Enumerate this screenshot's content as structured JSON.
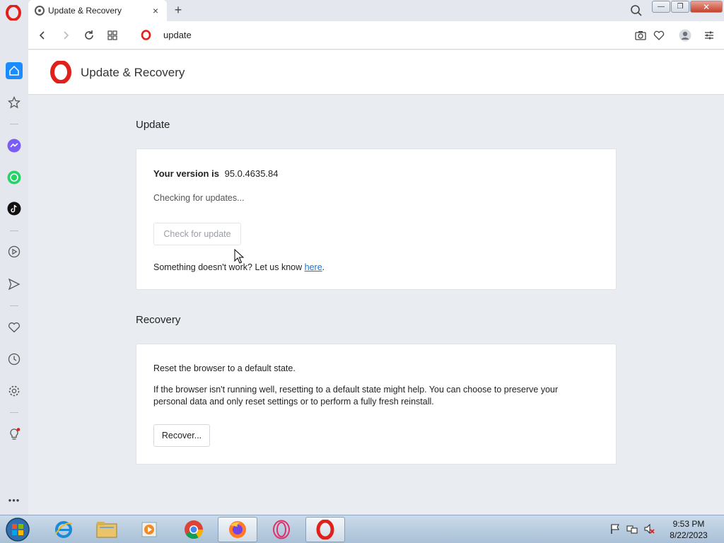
{
  "browser": {
    "tab": {
      "title": "Update & Recovery",
      "close": "×"
    },
    "new_tab": "+",
    "address": {
      "url": "update"
    },
    "window_buttons": {
      "minimize": "—",
      "restore": "❐",
      "close": "✕"
    }
  },
  "page": {
    "header_title": "Update & Recovery",
    "update": {
      "section_title": "Update",
      "version_label": "Your version is",
      "version_value": "95.0.4635.84",
      "status": "Checking for updates...",
      "check_button": "Check for update",
      "feedback_prefix": "Something doesn't work? Let us know ",
      "feedback_link": "here",
      "feedback_suffix": "."
    },
    "recovery": {
      "section_title": "Recovery",
      "heading": "Reset the browser to a default state.",
      "description_line1": "If the browser isn't running well, resetting to a default state might help. You can choose to preserve your",
      "description_line2": "personal data and only reset settings or to perform a fully fresh reinstall.",
      "recover_button": "Recover..."
    }
  },
  "sidebar": {
    "items": [
      "home-icon",
      "bookmarks-icon",
      "messenger-icon",
      "whatsapp-icon",
      "tiktok-icon",
      "player-icon",
      "send-icon",
      "heart-icon",
      "history-icon",
      "settings-icon",
      "lightbulb-icon",
      "more-icon"
    ],
    "more": "•••"
  },
  "taskbar": {
    "time": "9:53 PM",
    "date": "8/22/2023"
  },
  "colors": {
    "opera_red": "#e0201b",
    "accent_blue": "#1a8cff",
    "link": "#1a73d9"
  }
}
